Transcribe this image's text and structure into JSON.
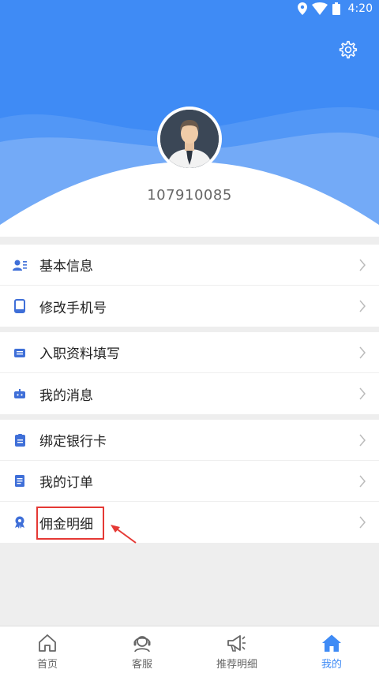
{
  "status_bar": {
    "time": "4:20",
    "icons": [
      "location-icon",
      "wifi-icon",
      "battery-icon"
    ]
  },
  "header": {
    "settings_icon": "gear-icon",
    "username": "107910085"
  },
  "menu_groups": [
    {
      "items": [
        {
          "label": "基本信息",
          "icon": "user-card-icon"
        },
        {
          "label": "修改手机号",
          "icon": "phone-icon"
        }
      ]
    },
    {
      "items": [
        {
          "label": "入职资料填写",
          "icon": "form-icon"
        },
        {
          "label": "我的消息",
          "icon": "message-icon"
        }
      ]
    },
    {
      "items": [
        {
          "label": "绑定银行卡",
          "icon": "bank-card-icon"
        },
        {
          "label": "我的订单",
          "icon": "order-icon"
        },
        {
          "label": "佣金明细",
          "icon": "commission-icon"
        }
      ]
    }
  ],
  "tabbar": [
    {
      "label": "首页",
      "icon": "home-outline-icon",
      "active": false
    },
    {
      "label": "客服",
      "icon": "headset-icon",
      "active": false
    },
    {
      "label": "推荐明细",
      "icon": "megaphone-icon",
      "active": false
    },
    {
      "label": "我的",
      "icon": "home-filled-icon",
      "active": true
    }
  ],
  "colors": {
    "primary": "#3f8bf5",
    "highlight": "#e53935",
    "background": "#eeeeee"
  }
}
